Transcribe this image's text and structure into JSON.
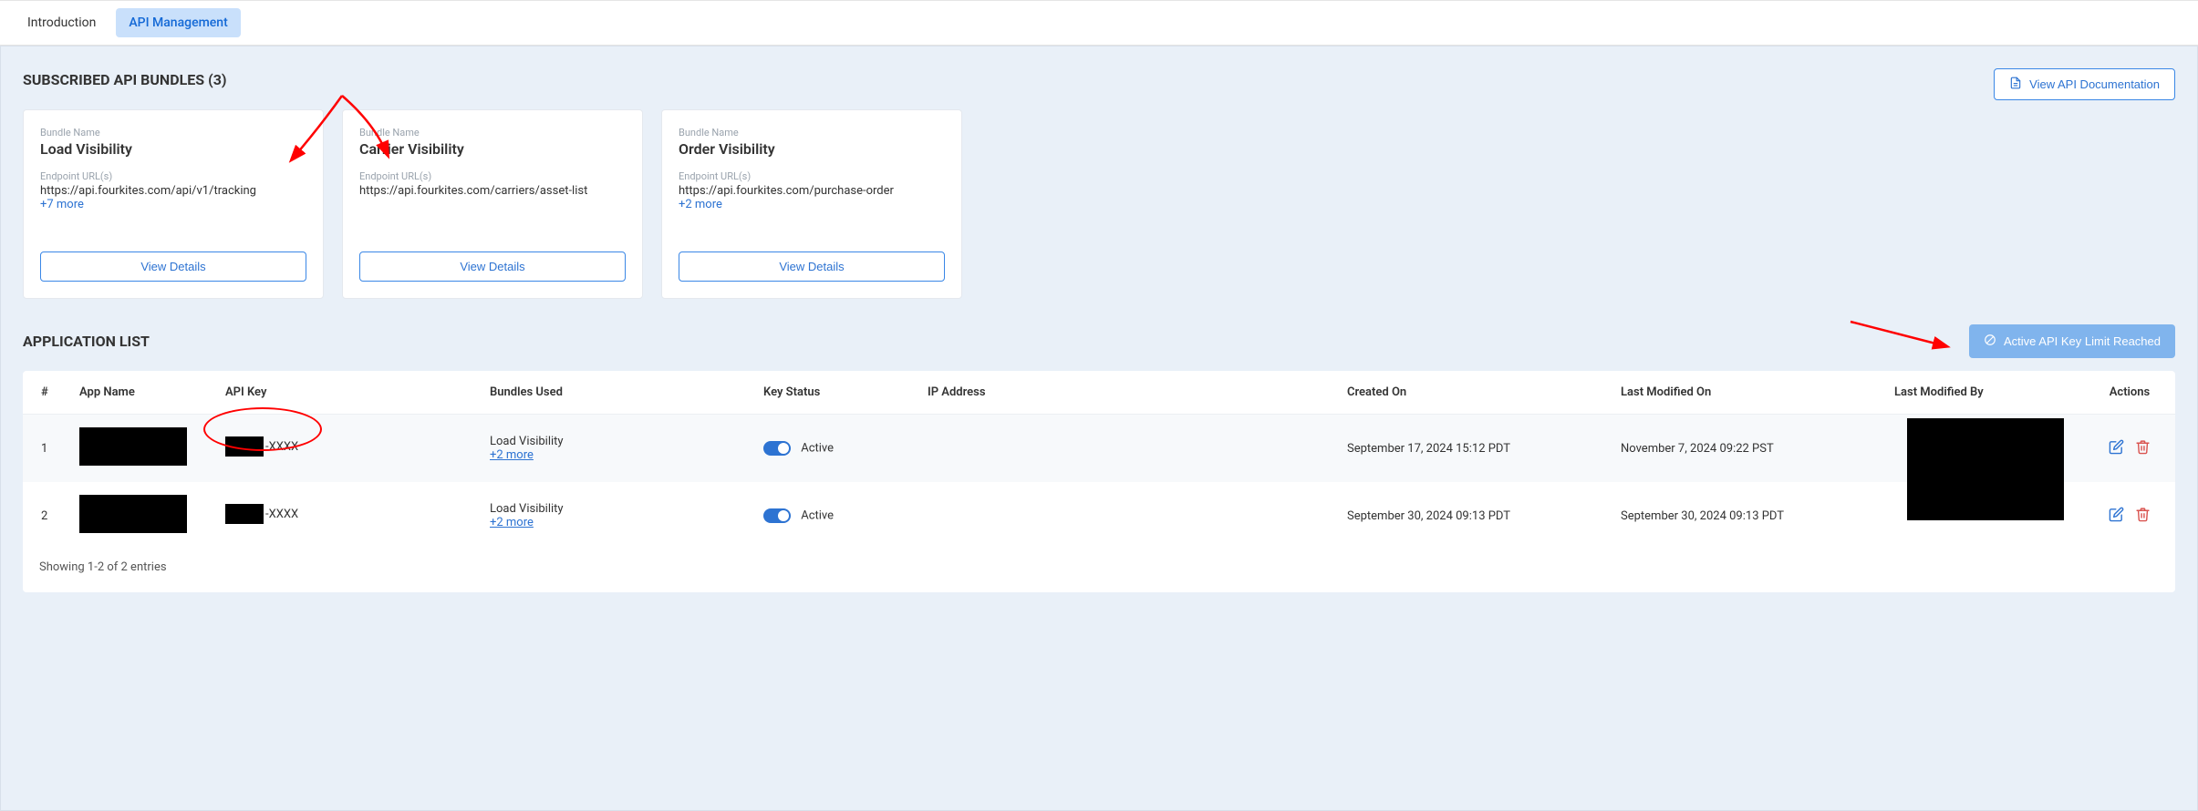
{
  "tabs": {
    "introduction": "Introduction",
    "api_management": "API Management"
  },
  "bundles_section": {
    "title": "SUBSCRIBED API BUNDLES (3)",
    "docs_button": "View API Documentation",
    "bundle_label": "Bundle Name",
    "endpoint_label": "Endpoint URL(s)",
    "view_details": "View Details",
    "cards": [
      {
        "name": "Load Visibility",
        "endpoint": "https://api.fourkites.com/api/v1/tracking",
        "more": "+7 more"
      },
      {
        "name": "Carrier Visibility",
        "endpoint": "https://api.fourkites.com/carriers/asset-list",
        "more": ""
      },
      {
        "name": "Order Visibility",
        "endpoint": "https://api.fourkites.com/purchase-order",
        "more": "+2 more"
      }
    ]
  },
  "app_list": {
    "title": "APPLICATION LIST",
    "limit_button": "Active API Key Limit Reached",
    "columns": {
      "num": "#",
      "app_name": "App Name",
      "api_key": "API Key",
      "bundles_used": "Bundles Used",
      "key_status": "Key Status",
      "ip_address": "IP Address",
      "created_on": "Created On",
      "last_modified_on": "Last Modified On",
      "last_modified_by": "Last Modified By",
      "actions": "Actions"
    },
    "rows": [
      {
        "num": "1",
        "api_key_suffix": "-XXXX",
        "bundle_primary": "Load Visibility",
        "bundle_more": "+2 more",
        "status": "Active",
        "created": "September 17, 2024 15:12 PDT",
        "modified": "November 7, 2024 09:22 PST"
      },
      {
        "num": "2",
        "api_key_suffix": "-XXXX",
        "bundle_primary": "Load Visibility",
        "bundle_more": "+2 more",
        "status": "Active",
        "created": "September 30, 2024 09:13 PDT",
        "modified": "September 30, 2024 09:13 PDT"
      }
    ],
    "footer": "Showing 1-2 of 2 entries"
  }
}
